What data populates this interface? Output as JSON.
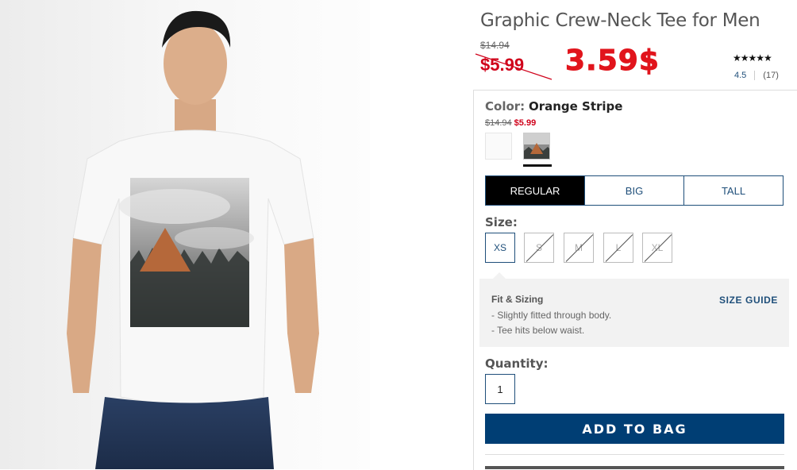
{
  "product": {
    "title": "Graphic Crew-Neck Tee for Men",
    "original_price": "$14.94",
    "sale_price": "$5.99",
    "overlay_price": "3.59$",
    "rating_stars": "★★★★★",
    "rating_value": "4.5",
    "review_count": "(17)"
  },
  "color": {
    "label": "Color:",
    "selected": "Orange Stripe",
    "original_price": "$14.94",
    "sale_price": "$5.99",
    "swatches": [
      "white",
      "orange-stripe"
    ]
  },
  "fit_tabs": [
    "REGULAR",
    "BIG",
    "TALL"
  ],
  "size": {
    "label": "Size:",
    "options": [
      "XS",
      "S",
      "M",
      "L",
      "XL"
    ],
    "selected": "XS",
    "unavailable": [
      "S",
      "M",
      "L",
      "XL"
    ]
  },
  "fit_info": {
    "title": "Fit & Sizing",
    "lines": [
      "-  Slightly fitted through body.",
      "-  Tee hits below waist."
    ],
    "size_guide": "SIZE GUIDE"
  },
  "quantity": {
    "label": "Quantity:",
    "value": "1"
  },
  "add_to_bag": "ADD TO BAG",
  "colors": {
    "brand_navy": "#003e74",
    "sale_red": "#d0021b"
  }
}
